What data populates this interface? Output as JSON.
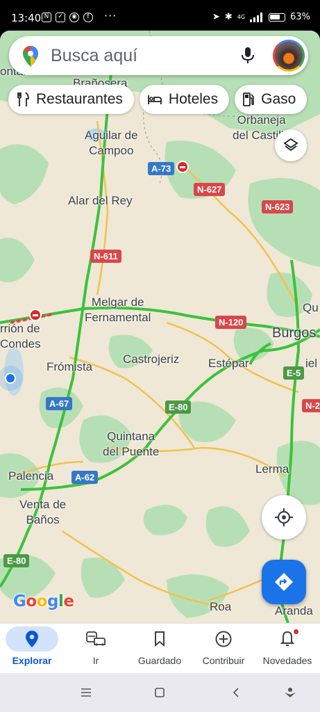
{
  "status_bar": {
    "time": "13:40",
    "network": "4G",
    "battery": "63%"
  },
  "search": {
    "placeholder": "Busca aquí"
  },
  "chips": [
    {
      "label": "Restaurantes",
      "icon": "fork-knife-icon"
    },
    {
      "label": "Hoteles",
      "icon": "bed-icon"
    },
    {
      "label": "Gaso",
      "icon": "gas-pump-icon"
    }
  ],
  "map": {
    "places": [
      {
        "name": "Brañosera"
      },
      {
        "name": "Aguilar de\nCampoo"
      },
      {
        "name": "Orbaneja\ndel Castillo"
      },
      {
        "name": "Alar del Rey"
      },
      {
        "name": "Melgar de\nFernamental"
      },
      {
        "name": "rrión de\nCondes"
      },
      {
        "name": "Burgos"
      },
      {
        "name": "Qu"
      },
      {
        "name": "Frómista"
      },
      {
        "name": "Castrojeriz"
      },
      {
        "name": "Estépar"
      },
      {
        "name": "Quintana\ndel Puente"
      },
      {
        "name": "Palencia"
      },
      {
        "name": "Venta de\nBaños"
      },
      {
        "name": "Lerma"
      },
      {
        "name": "Roa"
      },
      {
        "name": "Aranda"
      },
      {
        "name": "ontala"
      },
      {
        "name": "iel"
      }
    ],
    "road_shields": [
      {
        "label": "A-73",
        "color": "blue"
      },
      {
        "label": "N-627",
        "color": "red"
      },
      {
        "label": "N-623",
        "color": "red"
      },
      {
        "label": "N-611",
        "color": "red"
      },
      {
        "label": "N-120",
        "color": "red"
      },
      {
        "label": "E-5",
        "color": "green"
      },
      {
        "label": "A-67",
        "color": "blue"
      },
      {
        "label": "E-80",
        "color": "green"
      },
      {
        "label": "N-2",
        "color": "red"
      },
      {
        "label": "A-62",
        "color": "blue"
      },
      {
        "label": "E-80",
        "color": "green"
      }
    ],
    "attribution": "Google"
  },
  "bottom_nav": [
    {
      "label": "Explorar",
      "icon": "map-pin-icon",
      "active": true
    },
    {
      "label": "Ir",
      "icon": "commute-icon",
      "active": false
    },
    {
      "label": "Guardado",
      "icon": "bookmark-icon",
      "active": false
    },
    {
      "label": "Contribuir",
      "icon": "add-circle-icon",
      "active": false
    },
    {
      "label": "Novedades",
      "icon": "bell-icon",
      "active": false
    }
  ],
  "colors": {
    "accent": "#1a73e8",
    "map_land": "#efe8d6",
    "map_green": "#b7dfb5",
    "water": "#a9d3f0",
    "highway": "#3cc23c",
    "road_yellow": "#f3c14d"
  }
}
